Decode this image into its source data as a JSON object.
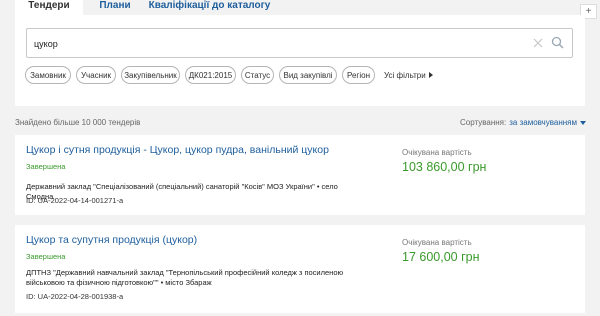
{
  "tabs": [
    {
      "label": "Тендери",
      "active": true
    },
    {
      "label": "Плани",
      "active": false
    },
    {
      "label": "Кваліфікації до каталогу",
      "active": false
    }
  ],
  "top_right_button": "+",
  "search": {
    "value": "цукор"
  },
  "filters": [
    "Замовник",
    "Учасник",
    "Закупівельник",
    "ДК021:2015",
    "Статус",
    "Вид закупівлі",
    "Регіон"
  ],
  "all_filters_label": "Усі фільтри",
  "results": {
    "found_text": "Знайдено більше 10 000 тендерів",
    "sort_label": "Сортування:",
    "sort_value": "за замовчуванням"
  },
  "tenders": [
    {
      "title": "Цукор і сутня продукція - Цукор, цукор пудра, ванільний цукор",
      "status": "Завершена",
      "organization": "Державний заклад \"Спеціалізований (спеціальний) санаторій \"Косів\" МОЗ України\" • село Смодна",
      "id": "ID: UA-2022-04-14-001271-a",
      "expected_label": "Очікувана вартість",
      "expected_value": "103 860,00 грн"
    },
    {
      "title": "Цукор та супутня продукція (цукор)",
      "status": "Завершена",
      "organization": "ДПТНЗ \"Державний навчальний заклад \"Тернопільський професійний коледж з посиленою військовою та фізичною підготовкою\"\" • місто Збараж",
      "id": "ID: UA-2022-04-28-001938-a",
      "expected_label": "Очікувана вартість",
      "expected_value": "17 600,00 грн"
    }
  ]
}
